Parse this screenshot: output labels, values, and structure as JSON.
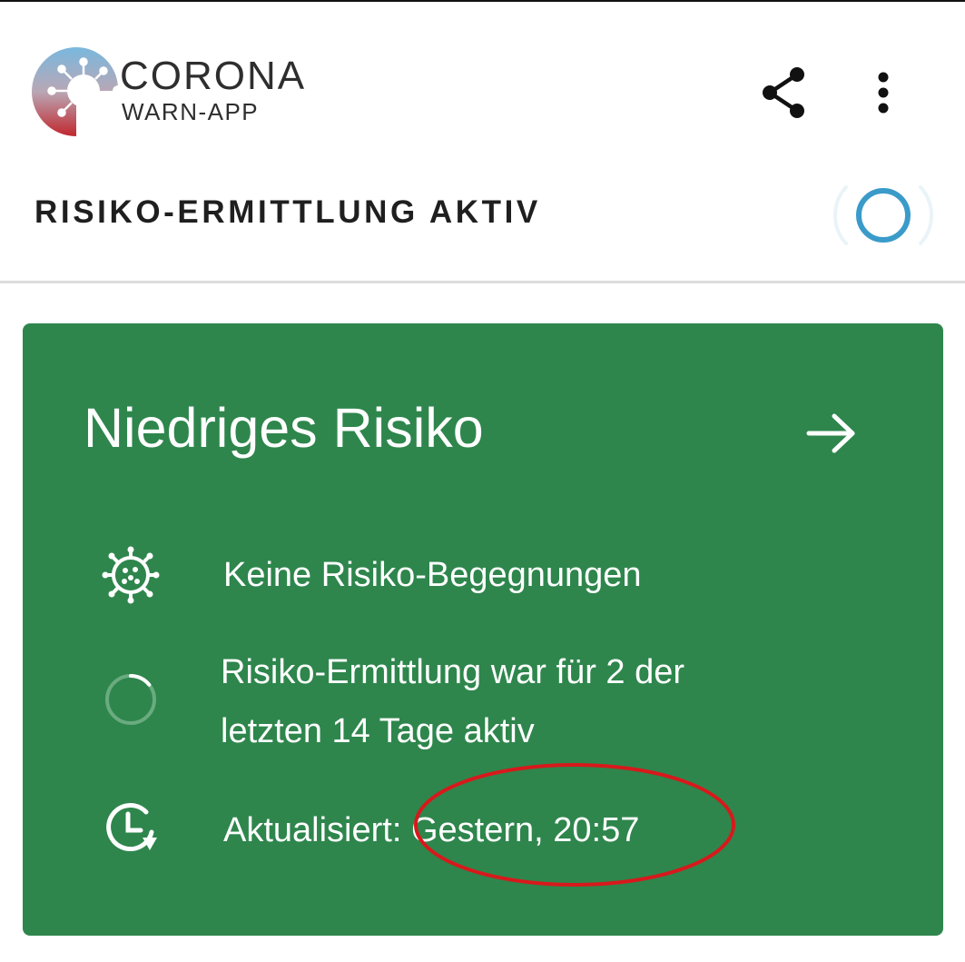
{
  "app": {
    "logo_title": "CORONA",
    "logo_subtitle": "WARN-APP",
    "logo_icon": "corona-virus-c-logo"
  },
  "toolbar": {
    "share_icon": "share-icon",
    "more_icon": "more-vertical-icon"
  },
  "status": {
    "label": "RISIKO-ERMITTLUNG AKTIV",
    "indicator_icon": "tracing-active-ring-icon"
  },
  "risk_card": {
    "title": "Niedriges Risiko",
    "arrow_icon": "arrow-right-icon",
    "background_color": "#2e864c",
    "rows": [
      {
        "icon": "virus-icon",
        "text": "Keine Risiko-Begegnungen"
      },
      {
        "icon": "progress-ring-icon",
        "text_line1": "Risiko-Ermittlung war für 2 der",
        "text_line2": "letzten 14 Tage aktiv",
        "progress_days": 2,
        "progress_total": 14
      },
      {
        "icon": "clock-refresh-icon",
        "text": "Aktualisiert: Gestern, 20:57"
      }
    ]
  },
  "annotation": {
    "shape": "ellipse",
    "color": "#d7191c"
  }
}
